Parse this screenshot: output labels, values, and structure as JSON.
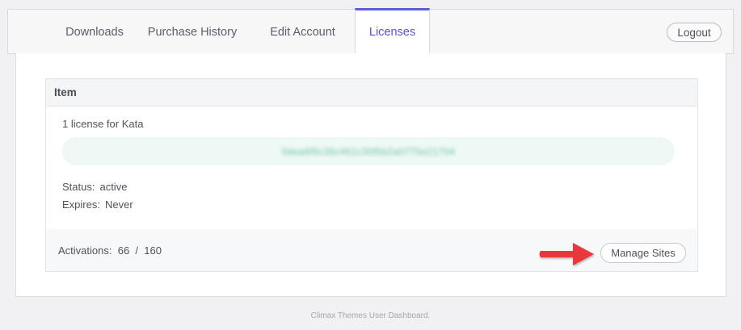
{
  "nav": {
    "tabs": [
      {
        "label": "Downloads",
        "active": false
      },
      {
        "label": "Purchase History",
        "active": false
      },
      {
        "label": "Edit Account",
        "active": false
      },
      {
        "label": "Licenses",
        "active": true
      }
    ],
    "logout_label": "Logout"
  },
  "table": {
    "header_item": "Item",
    "license_title": "1 license for Kata",
    "license_key": "0dea6f5c36c461c30f5b2a0775e21704",
    "status_label": "Status:",
    "status_value": "active",
    "expires_label": "Expires:",
    "expires_value": "Never",
    "activations_label": "Activations:",
    "activations_used": "66",
    "activations_sep": "/",
    "activations_total": "160",
    "manage_sites_label": "Manage Sites"
  },
  "footer": {
    "text": "Climax Themes User Dashboard."
  },
  "colors": {
    "accent": "#5454d4",
    "arrow": "#e8373a",
    "key_bg": "#eef8f4",
    "key_text": "#6fc5a7"
  }
}
